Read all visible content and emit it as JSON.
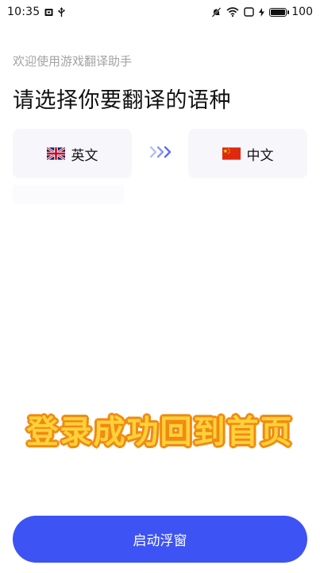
{
  "status_bar": {
    "time": "10:35",
    "battery_level": "100",
    "icons": [
      "sim-card-icon",
      "usb-icon",
      "mute-icon",
      "wifi-icon",
      "portrait-lock-icon",
      "charging-icon",
      "battery-icon"
    ]
  },
  "header": {
    "welcome": "欢迎使用游戏翻译助手",
    "title": "请选择你要翻译的语种"
  },
  "languages": {
    "source": {
      "label": "英文",
      "flag": "uk-flag-icon"
    },
    "target": {
      "label": "中文",
      "flag": "china-flag-icon"
    },
    "swap_icon": "triple-chevron-right-icon",
    "arrow_color": "#5a6cf2"
  },
  "overlay": {
    "text": "登录成功回到首页",
    "fill_color": "#ffd13a",
    "outline_color": "#f08a12"
  },
  "footer": {
    "start_button_label": "启动浮窗",
    "button_color": "#3d53f4"
  }
}
